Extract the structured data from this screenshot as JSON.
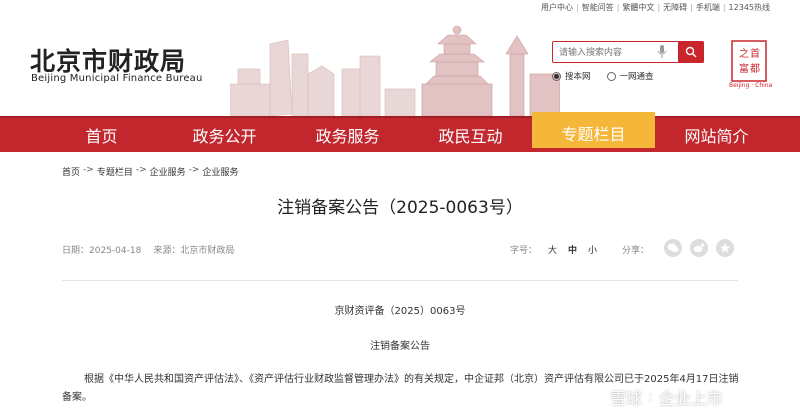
{
  "utility_bar": {
    "items": [
      "用户中心",
      "智能问答",
      "繁體中文",
      "无障碍",
      "手机端",
      "12345热线"
    ]
  },
  "header": {
    "site_name_cn": "北京市财政局",
    "site_name_en": "Beijing Municipal Finance Bureau",
    "search": {
      "placeholder": "请输入搜索内容"
    },
    "search_scope": {
      "option_site": "搜本网",
      "option_all": "一网通查",
      "selected": "option_site"
    },
    "seal": {
      "glyphs": [
        "之",
        "首",
        "都",
        "富"
      ],
      "caption": "Beijing · China"
    }
  },
  "nav": {
    "items": [
      {
        "label": "首页"
      },
      {
        "label": "政务公开"
      },
      {
        "label": "政务服务"
      },
      {
        "label": "政民互动"
      },
      {
        "label": "专题栏目",
        "active": true
      },
      {
        "label": "网站简介"
      }
    ]
  },
  "breadcrumb": {
    "items": [
      "首页",
      "专题栏目",
      "企业服务",
      "企业服务"
    ],
    "separator": "->"
  },
  "article": {
    "title": "注销备案公告（2025-0063号）",
    "date_label": "日期：",
    "date": "2025-04-18",
    "source_label": "来源：",
    "source": "北京市财政局",
    "fontsize_label": "字号：",
    "fontsize_large": "大",
    "fontsize_medium": "中",
    "fontsize_small": "小",
    "share_label": "分享：",
    "doc_number": "京财资评备（2025）0063号",
    "subtitle": "注销备案公告",
    "body": "根据《中华人民共和国资产评估法》、《资产评估行业财政监督管理办法》的有关规定，中企证邦（北京）资产评估有限公司已于2025年4月17日注销备案。"
  },
  "watermark": {
    "brand": "雪球",
    "account": "企业上市"
  },
  "colors": {
    "brand_red": "#c1272d",
    "active_tab": "#f4b73a"
  }
}
